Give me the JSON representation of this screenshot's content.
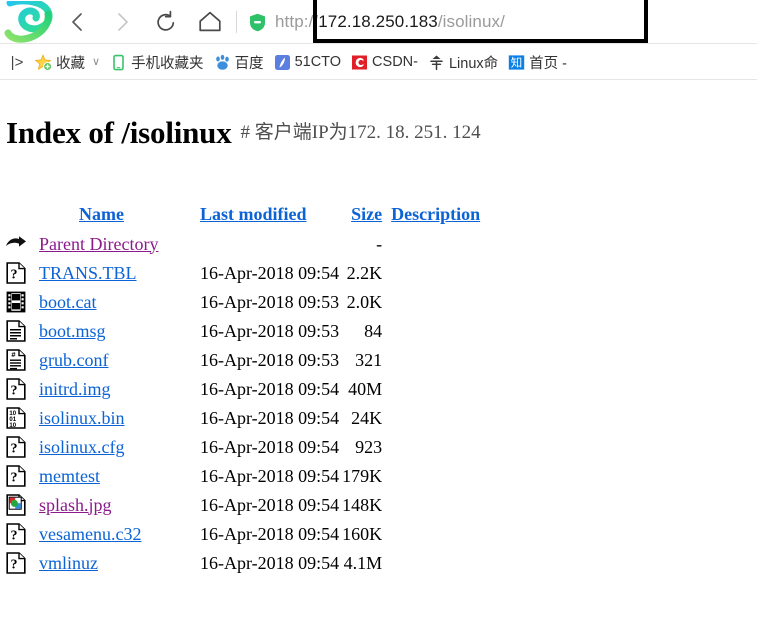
{
  "browser": {
    "logo_icon": "browser-logo-icon",
    "nav": [
      {
        "name": "back-button",
        "icon": "chevron-left-icon",
        "enabled": true
      },
      {
        "name": "forward-button",
        "icon": "chevron-right-icon",
        "enabled": false
      },
      {
        "name": "reload-button",
        "icon": "reload-icon",
        "enabled": true
      },
      {
        "name": "home-button",
        "icon": "home-icon",
        "enabled": true
      }
    ],
    "address_bar": {
      "security_icon": "shield-icon",
      "url_full": "http://172.18.250.183/isolinux/",
      "url_scheme": "http://",
      "url_host": "172.18.250.183",
      "url_path": "/isolinux/",
      "highlight_color": "#000000"
    },
    "bookmarks": {
      "overflow_label": "|>",
      "items": [
        {
          "label": "收藏",
          "icon": "star-favorites-icon",
          "caret": "∨"
        },
        {
          "label": "手机收藏夹",
          "icon": "phone-icon",
          "caret": ""
        },
        {
          "label": "百度",
          "icon": "baidu-paw-icon",
          "caret": ""
        },
        {
          "label": "51CTO",
          "icon": "51cto-icon",
          "caret": ""
        },
        {
          "label": "CSDN-",
          "icon": "csdn-icon",
          "caret": ""
        },
        {
          "label": "Linux命",
          "icon": "linux-command-icon",
          "caret": ""
        },
        {
          "label": "首页 -",
          "icon": "zhihu-icon",
          "caret": ""
        }
      ]
    }
  },
  "page": {
    "title": "Index of /isolinux",
    "annotation": "# 客户端IP为172. 18. 251. 124",
    "table": {
      "headers": {
        "icon": "",
        "name": "Name",
        "last_modified": "Last modified",
        "size": "Size",
        "description": "Description"
      },
      "rows": [
        {
          "icon": "parent-directory-icon",
          "name": "Parent Directory",
          "visited": true,
          "last_modified": "",
          "size": "-",
          "description": ""
        },
        {
          "icon": "unknown-file-icon",
          "name": "TRANS.TBL",
          "visited": false,
          "last_modified": "16-Apr-2018 09:54",
          "size": "2.2K",
          "description": ""
        },
        {
          "icon": "film-strip-icon",
          "name": "boot.cat",
          "visited": false,
          "last_modified": "16-Apr-2018 09:53",
          "size": "2.0K",
          "description": ""
        },
        {
          "icon": "text-document-icon",
          "name": "boot.msg",
          "visited": false,
          "last_modified": "16-Apr-2018 09:53",
          "size": "84",
          "description": ""
        },
        {
          "icon": "script-document-icon",
          "name": "grub.conf",
          "visited": false,
          "last_modified": "16-Apr-2018 09:53",
          "size": "321",
          "description": ""
        },
        {
          "icon": "unknown-file-icon",
          "name": "initrd.img",
          "visited": false,
          "last_modified": "16-Apr-2018 09:54",
          "size": "40M",
          "description": ""
        },
        {
          "icon": "binary-file-icon",
          "name": "isolinux.bin",
          "visited": false,
          "last_modified": "16-Apr-2018 09:54",
          "size": "24K",
          "description": ""
        },
        {
          "icon": "unknown-file-icon",
          "name": "isolinux.cfg",
          "visited": false,
          "last_modified": "16-Apr-2018 09:54",
          "size": "923",
          "description": ""
        },
        {
          "icon": "unknown-file-icon",
          "name": "memtest",
          "visited": false,
          "last_modified": "16-Apr-2018 09:54",
          "size": "179K",
          "description": ""
        },
        {
          "icon": "image-file-icon",
          "name": "splash.jpg",
          "visited": true,
          "last_modified": "16-Apr-2018 09:54",
          "size": "148K",
          "description": ""
        },
        {
          "icon": "unknown-file-icon",
          "name": "vesamenu.c32",
          "visited": false,
          "last_modified": "16-Apr-2018 09:54",
          "size": "160K",
          "description": ""
        },
        {
          "icon": "unknown-file-icon",
          "name": "vmlinuz",
          "visited": false,
          "last_modified": "16-Apr-2018 09:54",
          "size": "4.1M",
          "description": ""
        }
      ]
    }
  },
  "colors": {
    "link": "#0b63d6",
    "link_visited": "#8c1a8c",
    "text": "#000000",
    "annotation": "#4f4f4f",
    "url_host": "#1a1a1a",
    "url_dim": "#9a9a9a"
  }
}
